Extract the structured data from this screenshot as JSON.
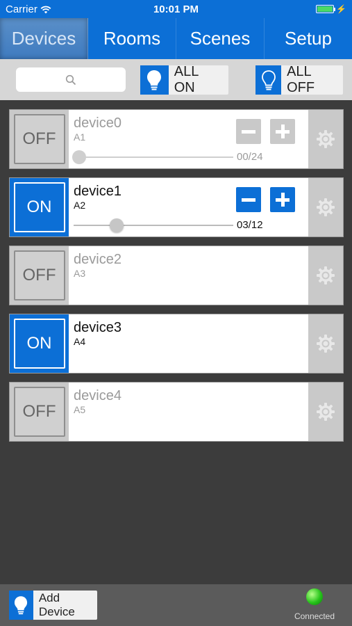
{
  "status_bar": {
    "carrier": "Carrier",
    "time": "10:01 PM",
    "wifi_icon": "wifi-icon",
    "battery_icon": "battery-icon"
  },
  "tabs": [
    {
      "label": "Devices",
      "active": true
    },
    {
      "label": "Rooms",
      "active": false
    },
    {
      "label": "Scenes",
      "active": false
    },
    {
      "label": "Setup",
      "active": false
    }
  ],
  "toolbar": {
    "search_placeholder": "",
    "all_on_label": "ALL ON",
    "all_off_label": "ALL OFF"
  },
  "devices": [
    {
      "name": "device0",
      "address": "A1",
      "state": "OFF",
      "dimmable": true,
      "level_text": "00/24",
      "level_fraction": 0.0
    },
    {
      "name": "device1",
      "address": "A2",
      "state": "ON",
      "dimmable": true,
      "level_text": "03/12",
      "level_fraction": 0.25
    },
    {
      "name": "device2",
      "address": "A3",
      "state": "OFF",
      "dimmable": false
    },
    {
      "name": "device3",
      "address": "A4",
      "state": "ON",
      "dimmable": false
    },
    {
      "name": "device4",
      "address": "A5",
      "state": "OFF",
      "dimmable": false
    }
  ],
  "bottom_bar": {
    "add_device_label": "Add Device",
    "connection_status": "Connected"
  },
  "colors": {
    "accent": "#0c6fd6",
    "background": "#3c3c3c",
    "connected": "#26c41a"
  }
}
